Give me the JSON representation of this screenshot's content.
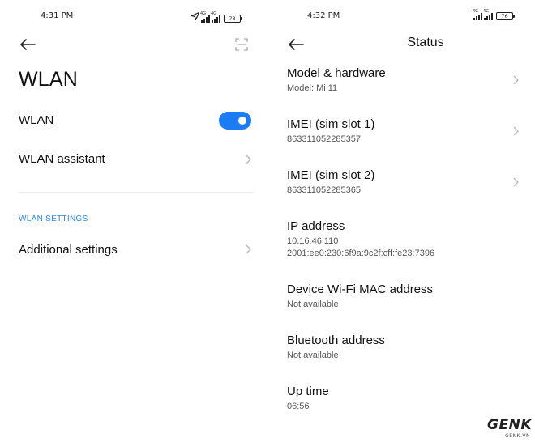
{
  "left_screen": {
    "status_bar": {
      "time": "4:31 PM",
      "network_tag": "4G",
      "battery": "73"
    },
    "title": "WLAN",
    "wlan_toggle": {
      "label": "WLAN",
      "on": true
    },
    "wlan_assistant": {
      "label": "WLAN assistant"
    },
    "section_header": "WLAN SETTINGS",
    "additional_settings": {
      "label": "Additional settings"
    }
  },
  "right_screen": {
    "status_bar": {
      "time": "4:32 PM",
      "network_tag": "4G",
      "battery": "76"
    },
    "title": "Status",
    "items": [
      {
        "title": "Model & hardware",
        "subtitle": "Model: Mi 11"
      },
      {
        "title": "IMEI (sim slot 1)",
        "subtitle": "863311052285357"
      },
      {
        "title": "IMEI (sim slot 2)",
        "subtitle": "863311052285365"
      },
      {
        "title": "IP address",
        "subtitle": "10.16.46.110",
        "subtitle2": "2001:ee0:230:6f9a:9c2f:cff:fe23:7396"
      },
      {
        "title": "Device Wi-Fi MAC address",
        "subtitle": "Not available"
      },
      {
        "title": "Bluetooth address",
        "subtitle": "Not available"
      },
      {
        "title": "Up time",
        "subtitle": "06:56"
      }
    ]
  },
  "watermark": {
    "brand": "GENK",
    "site": "GENK.VN"
  },
  "colors": {
    "accent": "#1b7cf3",
    "section_header": "#2c84e8",
    "chevron": "#b5b5b5"
  },
  "icons": [
    "back-arrow-icon",
    "scan-icon",
    "chevron-right-icon",
    "location-arrow-icon",
    "signal-icon",
    "battery-icon"
  ]
}
